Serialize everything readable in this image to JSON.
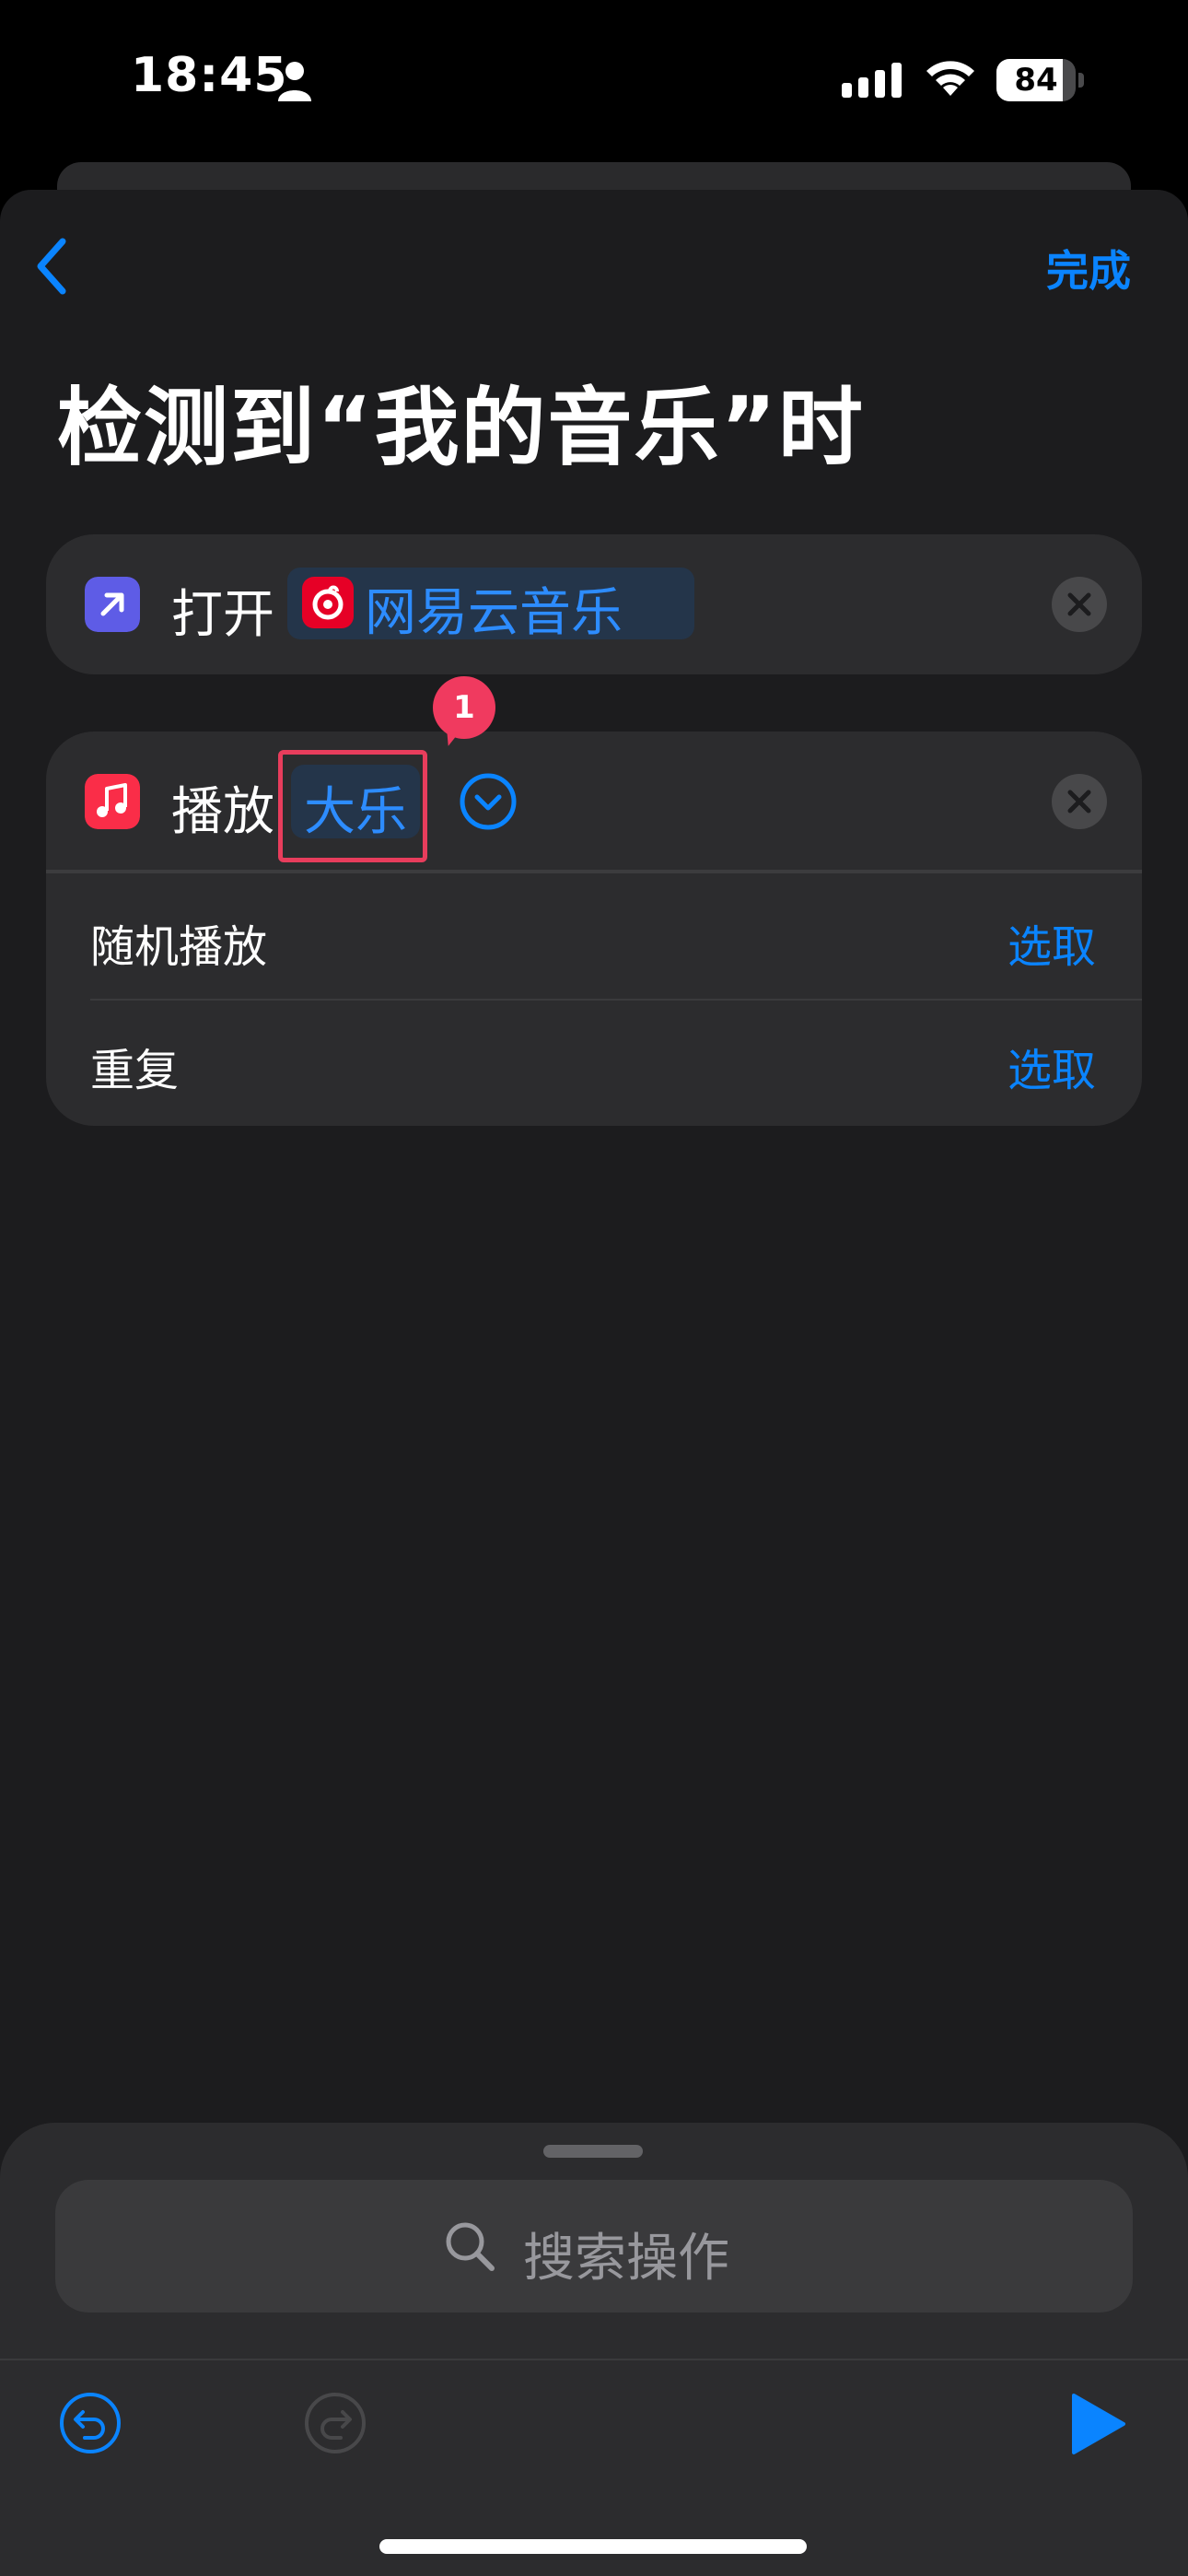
{
  "status_bar": {
    "time": "18:45",
    "battery": "84",
    "battery_level_percent": 84
  },
  "nav": {
    "done_label": "完成"
  },
  "page_title": "检测到“我的音乐”时",
  "actions": [
    {
      "verb": "打开",
      "value": "网易云音乐",
      "icon": "arrow-up-right-icon",
      "color": "#5e5ce6"
    },
    {
      "verb": "播放",
      "value": "大乐",
      "icon": "music-note-icon",
      "color": "#fa2d48",
      "params": [
        {
          "label": "随机播放",
          "value": "选取"
        },
        {
          "label": "重复",
          "value": "选取"
        }
      ]
    }
  ],
  "annotation": {
    "badge": "1"
  },
  "search": {
    "placeholder": "搜索操作"
  },
  "colors": {
    "accent": "#0a84ff",
    "background": "#1c1c1e",
    "card": "#2c2c2e",
    "highlight": "#e83d5c"
  }
}
